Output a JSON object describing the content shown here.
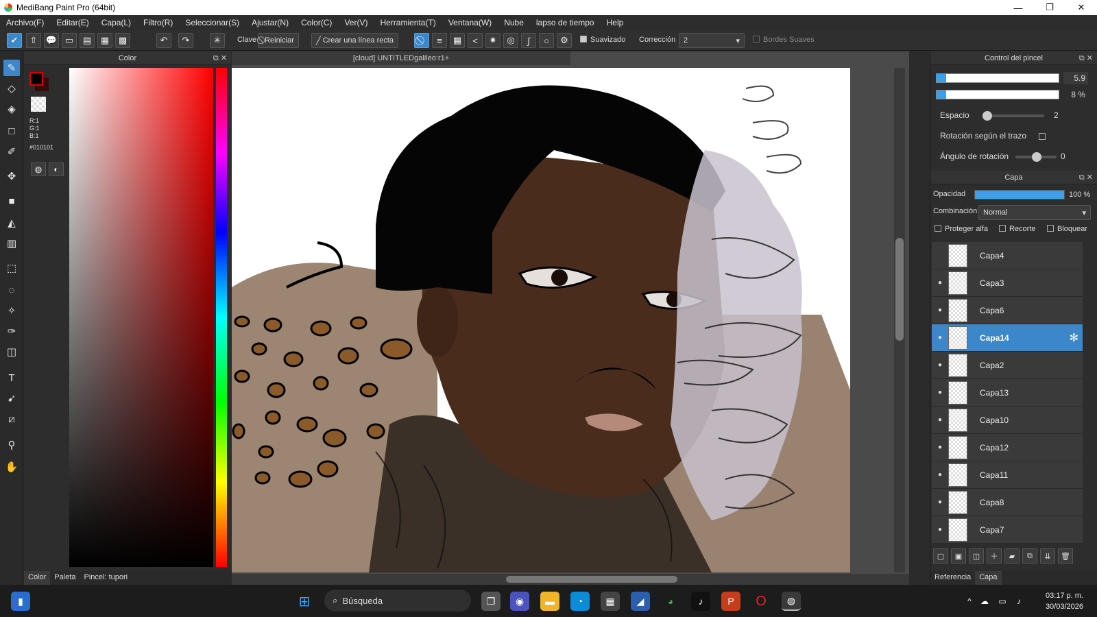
{
  "window": {
    "title": "MediBang Paint Pro (64bit)",
    "min": "—",
    "max": "❐",
    "close": "✕"
  },
  "menu": [
    "Archivo(F)",
    "Editar(E)",
    "Capa(L)",
    "Filtro(R)",
    "Seleccionar(S)",
    "Ajustar(N)",
    "Color(C)",
    "Ver(V)",
    "Herramienta(T)",
    "Ventana(W)",
    "Nube",
    "lapso de tiempo",
    "Help"
  ],
  "toolbar": {
    "clave": "Clave",
    "reiniciar": "Reiniciar",
    "linea_recta": "Crear una línea recta",
    "suavizado": "Suavizado",
    "correccion": "Corrección",
    "correccion_value": "2",
    "bordes_suaves": "Bordes Suaves"
  },
  "color_panel": {
    "title": "Color",
    "r": "R:1",
    "g": "G:1",
    "b": "B:1",
    "hex": "#010101",
    "fg_color": "#010101",
    "tabs": [
      "Color",
      "Paleta",
      "Pincel: tupori"
    ]
  },
  "document": {
    "tab": "[cloud] UNTITLEDgalileo:r1+"
  },
  "brush_control": {
    "title": "Control del pincel",
    "size_value": "5.9",
    "size_fraction": 0.08,
    "opacity_value": "8 %",
    "opacity_fraction": 0.08,
    "espacio_label": "Espacio",
    "espacio_value": "2",
    "rotacion_label": "Rotación según el trazo",
    "angulo_label": "Ángulo de rotación",
    "angulo_value": "0"
  },
  "layer_panel": {
    "title": "Capa",
    "opacidad_label": "Opacidad",
    "opacidad_value": "100 %",
    "opacidad_fraction": 1.0,
    "combinacion_label": "Combinación",
    "combinacion_value": "Normal",
    "proteger_alfa": "Proteger alfa",
    "recorte": "Recorte",
    "bloquear": "Bloquear",
    "layers": [
      {
        "name": "Capa4",
        "visible": false,
        "selected": false
      },
      {
        "name": "Capa3",
        "visible": true,
        "selected": false
      },
      {
        "name": "Capa6",
        "visible": true,
        "selected": false
      },
      {
        "name": "Capa14",
        "visible": true,
        "selected": true
      },
      {
        "name": "Capa2",
        "visible": true,
        "selected": false
      },
      {
        "name": "Capa13",
        "visible": true,
        "selected": false
      },
      {
        "name": "Capa10",
        "visible": true,
        "selected": false
      },
      {
        "name": "Capa12",
        "visible": true,
        "selected": false
      },
      {
        "name": "Capa11",
        "visible": true,
        "selected": false
      },
      {
        "name": "Capa8",
        "visible": true,
        "selected": false
      },
      {
        "name": "Capa7",
        "visible": true,
        "selected": false
      }
    ],
    "bottom_tabs": [
      "Referencia",
      "Capa"
    ]
  },
  "taskbar": {
    "search_placeholder": "Búsqueda",
    "time": "03:17 p. m.",
    "date": "30/03/2026"
  },
  "colors": {
    "accent": "#3b87c9",
    "skin": "#4a2c1c",
    "hair": "#050505",
    "bg_tan": "#9a8270"
  }
}
